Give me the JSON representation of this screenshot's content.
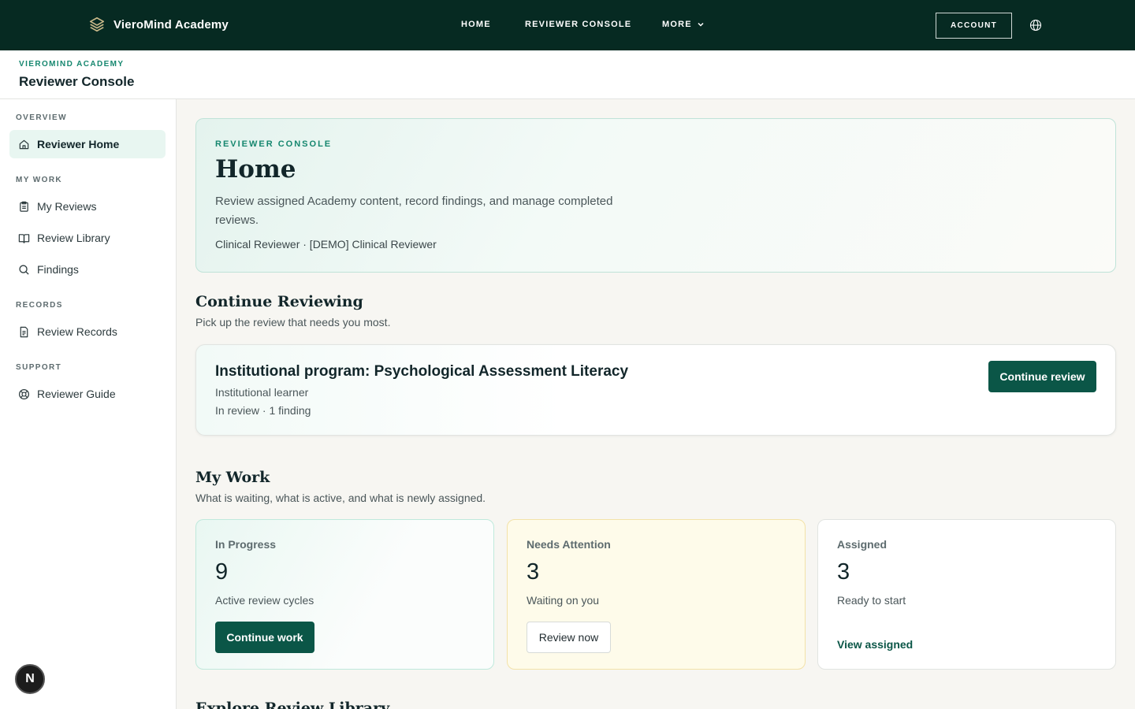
{
  "topbar": {
    "brand": "VieroMind Academy",
    "nav": {
      "home": "HOME",
      "reviewer_console": "REVIEWER CONSOLE",
      "more": "MORE"
    },
    "account": "ACCOUNT"
  },
  "subheader": {
    "eyebrow": "VIEROMIND ACADEMY",
    "title": "Reviewer Console"
  },
  "sidebar": {
    "sections": {
      "overview": "OVERVIEW",
      "my_work": "MY WORK",
      "records": "RECORDS",
      "support": "SUPPORT"
    },
    "items": [
      {
        "label": "Reviewer Home",
        "icon": "home-icon",
        "active": true
      },
      {
        "label": "My Reviews",
        "icon": "clipboard-icon"
      },
      {
        "label": "Review Library",
        "icon": "book-icon"
      },
      {
        "label": "Findings",
        "icon": "search-icon"
      },
      {
        "label": "Review Records",
        "icon": "document-icon"
      },
      {
        "label": "Reviewer Guide",
        "icon": "lifebuoy-icon"
      }
    ],
    "badge": "N"
  },
  "hero": {
    "eyebrow": "REVIEWER CONSOLE",
    "title": "Home",
    "description": "Review assigned Academy content, record findings, and manage completed reviews.",
    "role": "Clinical Reviewer · [DEMO] Clinical Reviewer"
  },
  "continue_section": {
    "title": "Continue Reviewing",
    "subtitle": "Pick up the review that needs you most.",
    "card": {
      "title": "Institutional program: Psychological Assessment Literacy",
      "learner": "Institutional learner",
      "status": "In review · 1 finding",
      "button": "Continue review"
    }
  },
  "work_section": {
    "title": "My Work",
    "subtitle": "What is waiting, what is active, and what is newly assigned.",
    "cards": [
      {
        "label": "In Progress",
        "value": "9",
        "desc": "Active review cycles",
        "action": "Continue work"
      },
      {
        "label": "Needs Attention",
        "value": "3",
        "desc": "Waiting on you",
        "action": "Review now"
      },
      {
        "label": "Assigned",
        "value": "3",
        "desc": "Ready to start",
        "action": "View assigned"
      }
    ]
  },
  "library_section": {
    "title": "Explore Review Library"
  },
  "colors": {
    "brand_dark": "#062a22",
    "accent": "#16876f",
    "primary_button": "#0b5647"
  }
}
